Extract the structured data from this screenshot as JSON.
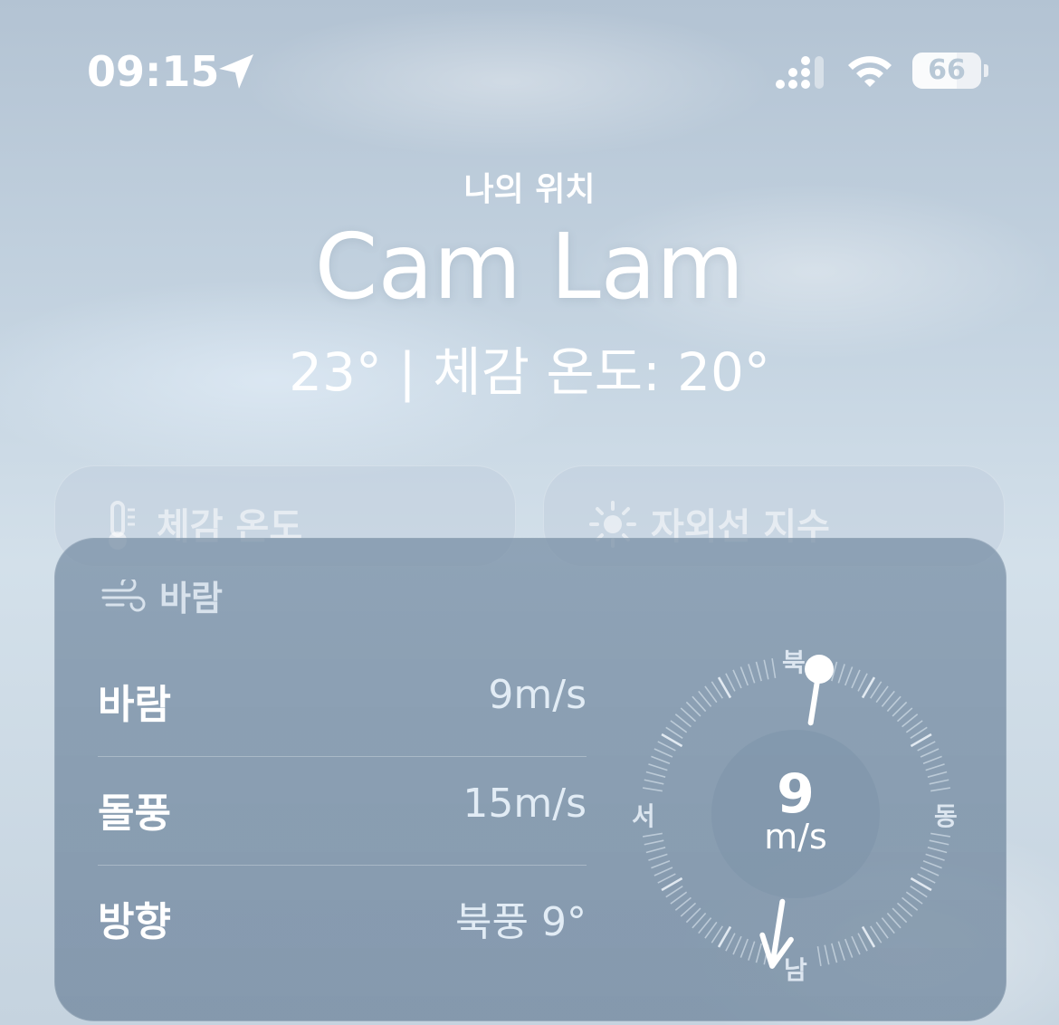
{
  "status_bar": {
    "time": "09:15",
    "battery": "66",
    "icons": [
      "location-arrow-icon",
      "cellular-signal-icon",
      "wifi-icon",
      "battery-icon"
    ]
  },
  "header": {
    "location_label": "나의 위치",
    "city": "Cam Lam",
    "temperature_line": "23° | 체감 온도: 20°"
  },
  "cards": {
    "feels_like": {
      "title": "체감 온도",
      "icon": "thermometer-icon"
    },
    "uv_index": {
      "title": "자외선 지수",
      "icon": "sun-icon"
    }
  },
  "wind": {
    "title": "바람",
    "icon": "wind-icon",
    "rows": [
      {
        "label": "바람",
        "value": "9m/s"
      },
      {
        "label": "돌풍",
        "value": "15m/s"
      },
      {
        "label": "방향",
        "value": "북풍 9°"
      }
    ],
    "compass": {
      "speed": "9",
      "unit": "m/s",
      "north": "북",
      "east": "동",
      "south": "남",
      "west": "서",
      "direction_degrees": 9
    }
  }
}
